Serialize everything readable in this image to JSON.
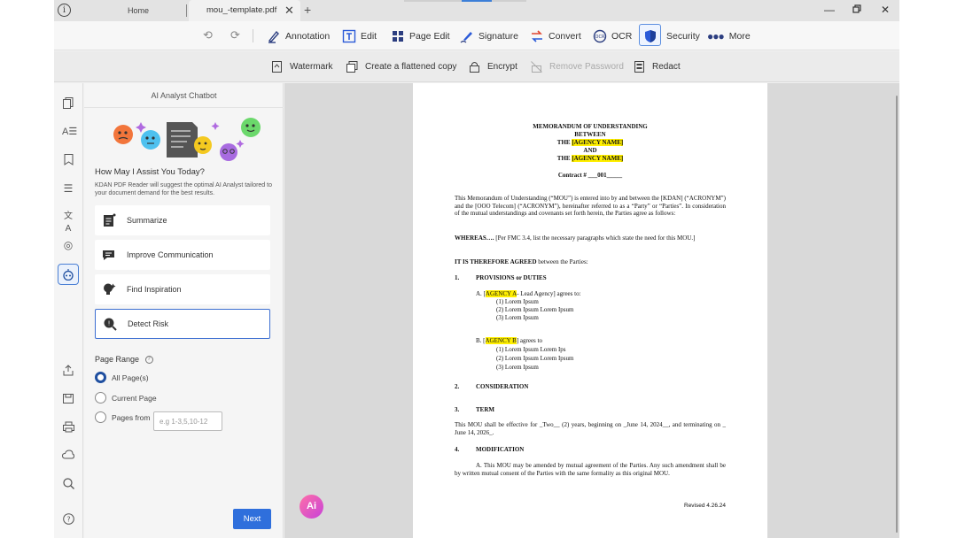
{
  "titlebar": {
    "info_glyph": "i",
    "tab_home": "Home",
    "tab_doc": "mou_-template.pdf",
    "close_glyph": "✕",
    "add_glyph": "+"
  },
  "toolbar": {
    "annotation": "Annotation",
    "edit": "Edit",
    "page_edit": "Page Edit",
    "signature": "Signature",
    "convert": "Convert",
    "ocr": "OCR",
    "security": "Security",
    "more": "More"
  },
  "subtoolbar": {
    "watermark": "Watermark",
    "flatten": "Create a flattened copy",
    "encrypt": "Encrypt",
    "remove_password": "Remove Password",
    "redact": "Redact"
  },
  "panel": {
    "title": "AI Analyst Chatbot",
    "assist_title": "How May I Assist You Today?",
    "assist_desc": "KDAN PDF Reader will suggest the optimal AI Analyst tailored to your document demand for the best results.",
    "options": [
      "Summarize",
      "Improve Communication",
      "Find Inspiration",
      "Detect Risk"
    ],
    "range_title": "Page Range",
    "range_all": "All Page(s)",
    "range_current": "Current Page",
    "range_from": "Pages from",
    "range_placeholder": "e.g 1-3,5,10-12",
    "next": "Next"
  },
  "fab": {
    "label": "Ai"
  },
  "document": {
    "title1": "MEMORANDUM OF UNDERSTANDING",
    "title2": "BETWEEN",
    "the": "THE",
    "agency_name": "[AGENCY NAME]",
    "and": "AND",
    "contract": "Contract # ___001_____",
    "intro": "This Memorandum of Understanding (“MOU”) is entered into by and between the [KDAN] (“ACRONYM”) and the [OOO Telecom] (“ACRONYM”), hereinafter referred to as a “Party” or “Parties”. In consideration of the mutual understandings and covenants set forth herein, the Parties agree as follows:",
    "whereas_label": "WHEREAS….",
    "whereas_text": "[Per FMC 3.4, list the necessary paragraphs which state the need for this MOU.]",
    "agreed_label": "IT IS THEREFORE AGREED",
    "agreed_text": "between the Parties:",
    "s1_num": "1.",
    "s1_title": "PROVISIONS or DUTIES",
    "a_prefix": "A. [",
    "agency_a": "AGENCY A",
    "a_suffix": "- Lead Agency] agrees to:",
    "a_items": [
      "(1) Lorem Ipsum",
      "(2) Lorem Ipsum Lorem Ipsum",
      "(3) Lorem Ipsum"
    ],
    "b_prefix": "B. [",
    "agency_b": "AGENCY B",
    "b_suffix": "] agrees to",
    "b_items": [
      "(1) Lorem Ipsum Lorem Ips",
      "(2) Lorem Ipsum Lorem Ipsum",
      "(3) Lorem Ipsum"
    ],
    "s2_num": "2.",
    "s2_title": "CONSIDERATION",
    "s3_num": "3.",
    "s3_title": "TERM",
    "term_text": "This MOU shall be effective for _Two__ (2) years, beginning on _June 14, 2024__, and terminating on _ June 14, 2026_.",
    "s4_num": "4.",
    "s4_title": "MODIFICATION",
    "mod_text": "A. This MOU may be amended by mutual agreement of the Parties. Any such amendment shall be by written mutual consent of the Parties with the same formality as this original MOU.",
    "revised": "Revised 4.26.24"
  },
  "colors": {
    "accent": "#2f6fdc",
    "highlight": "#ffef00",
    "active_border": "#3d6fd1"
  }
}
